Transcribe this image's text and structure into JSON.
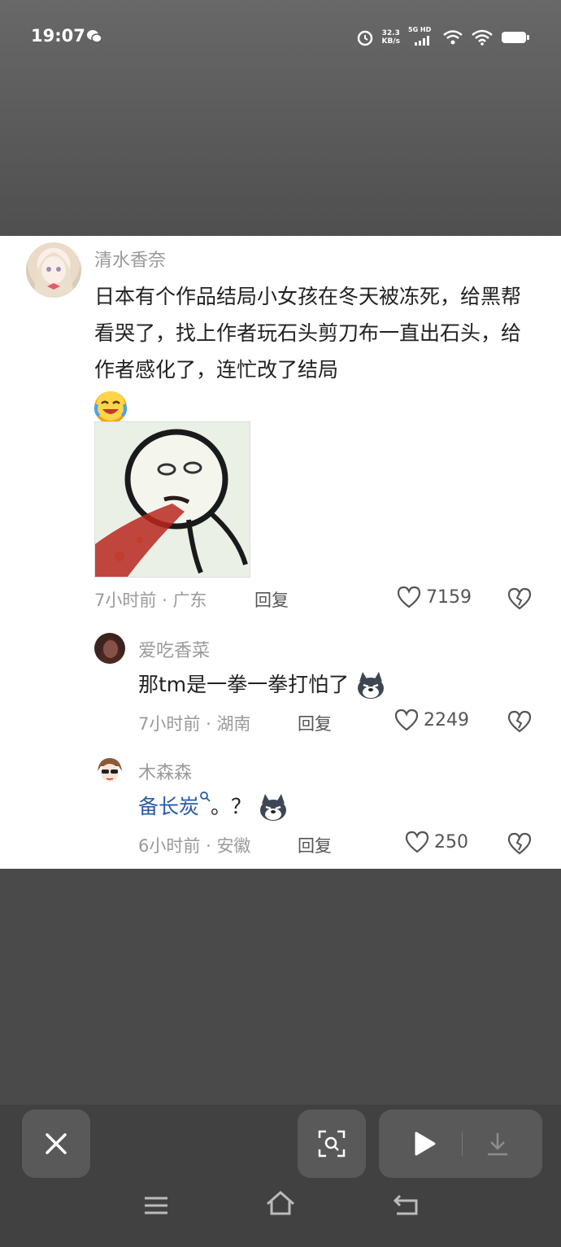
{
  "status_bar": {
    "time": "19:07",
    "speed_value": "32.3",
    "speed_unit": "KB/s",
    "network_label": "5G HD",
    "icons": [
      "wechat-icon",
      "alarm-icon",
      "signal-icon",
      "wifi-icon",
      "battery-icon"
    ]
  },
  "comment": {
    "username": "清水香奈",
    "text": "日本有个作品结局小女孩在冬天被冻死，给黑帮看哭了，找上作者玩石头剪刀布一直出石头，给作者感化了，连忙改了结局",
    "emoji": "crying-laughing-emoji",
    "time": "7小时前",
    "location": "广东",
    "reply_label": "回复",
    "likes": "7159"
  },
  "replies": [
    {
      "username": "爱吃香菜",
      "text": "那tm是一拳一拳打怕了",
      "time": "7小时前",
      "location": "湖南",
      "reply_label": "回复",
      "likes": "2249"
    },
    {
      "username": "木森森",
      "link_text": "备长炭",
      "text": "。？",
      "time": "6小时前",
      "location": "安徽",
      "reply_label": "回复",
      "likes": "250"
    }
  ],
  "separator": "·",
  "colors": {
    "link": "#2a5ba8",
    "meta": "#9a9a9a",
    "toolbar": "#414141"
  }
}
